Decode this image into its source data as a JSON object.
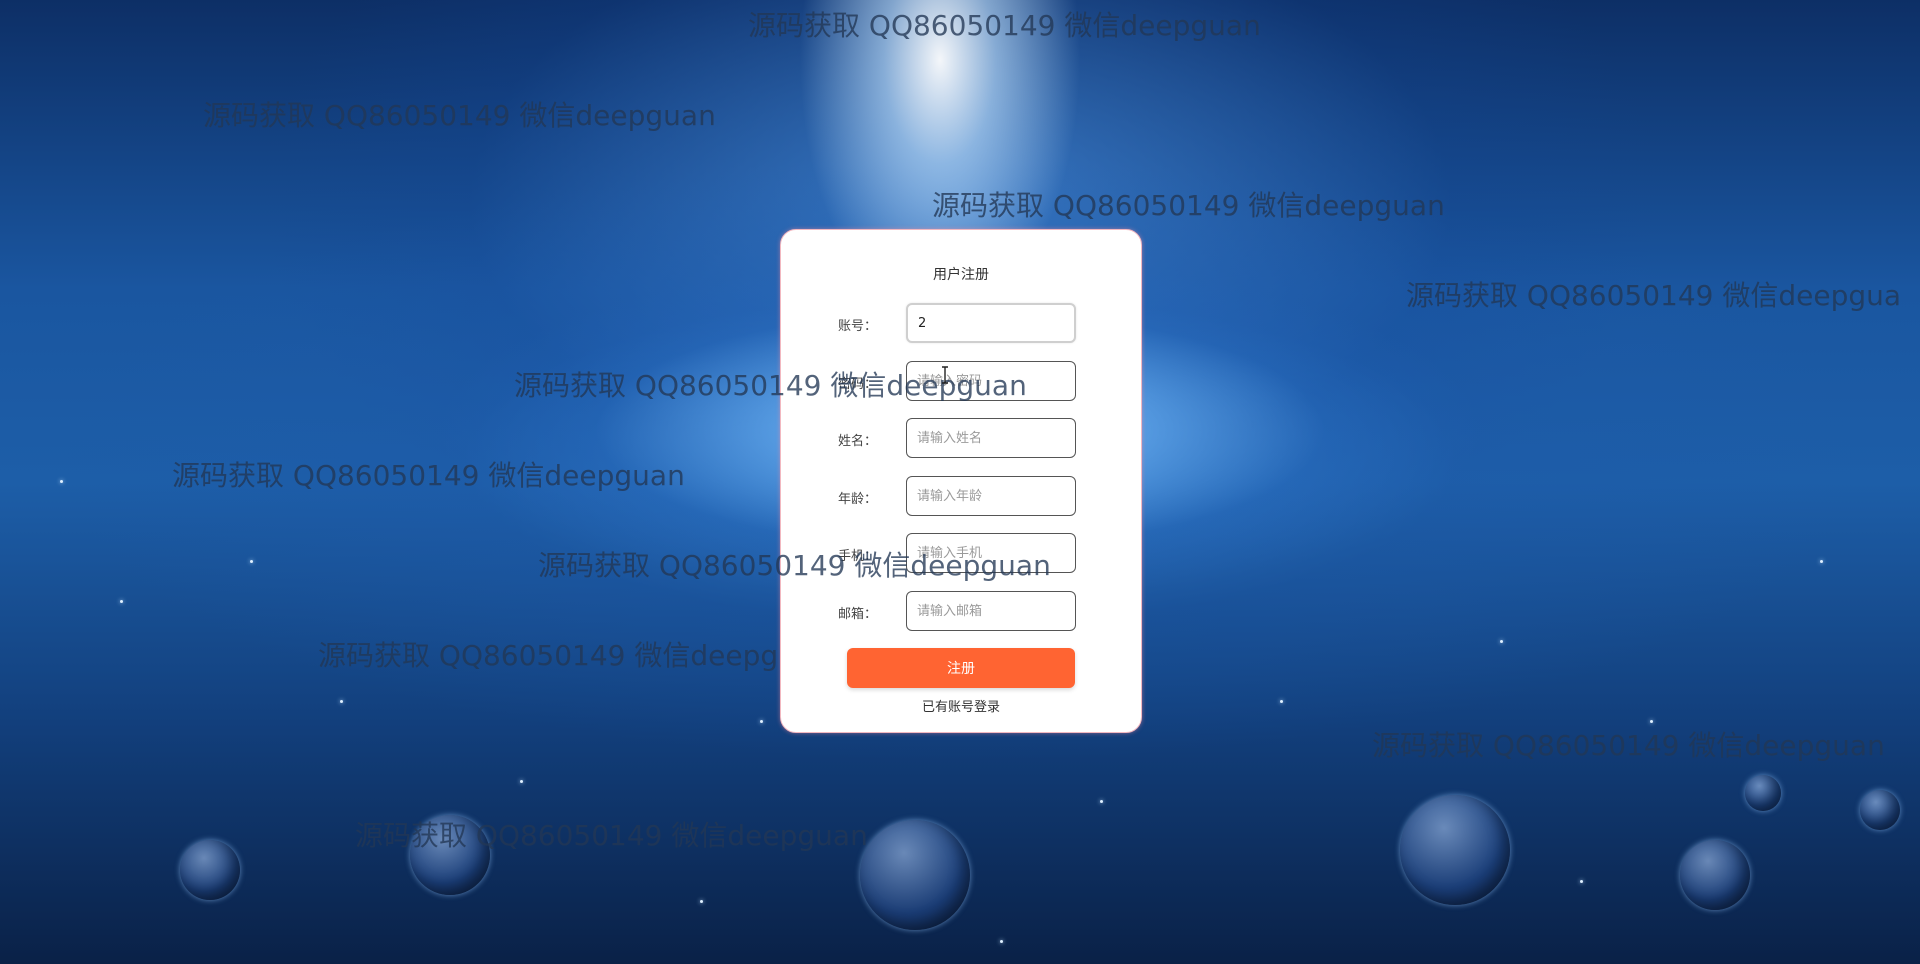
{
  "form": {
    "title": "用户注册",
    "fields": [
      {
        "label": "账号：",
        "value": "2",
        "placeholder": ""
      },
      {
        "label": "密码：",
        "value": "",
        "placeholder": "请输入密码"
      },
      {
        "label": "姓名：",
        "value": "",
        "placeholder": "请输入姓名"
      },
      {
        "label": "年龄：",
        "value": "",
        "placeholder": "请输入年龄"
      },
      {
        "label": "手机：",
        "value": "",
        "placeholder": "请输入手机"
      },
      {
        "label": "邮箱：",
        "value": "",
        "placeholder": "请输入邮箱"
      }
    ],
    "submit_label": "注册",
    "login_link": "已有账号登录"
  },
  "watermarks": [
    "源码获取 QQ86050149 微信deepguan",
    "源码获取 QQ86050149 微信deepguan",
    "源码获取 QQ86050149 微信deepguan",
    "源码获取 QQ86050149 微信deepgua",
    "源码获取 QQ86050149 微信deepguan",
    "源码获取 QQ86050149 微信deepguan",
    "源码获取 QQ86050149 微信deepguan",
    "源码获取 QQ86050149 微信deepguan",
    "源码获取 QQ86050149 微信deepguan",
    "源码获取 QQ86050149 微信deepguan"
  ],
  "colors": {
    "primary_button": "#ff6432",
    "card_background": "#ffffff",
    "card_border": "#f2b8c0"
  }
}
